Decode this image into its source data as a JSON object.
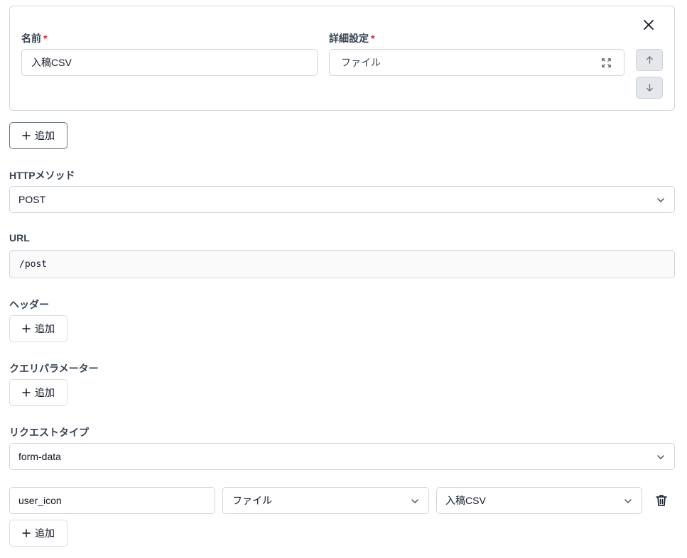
{
  "card": {
    "name_label": "名前",
    "name_required": "*",
    "name_value": "入稿CSV",
    "detail_label": "詳細設定",
    "detail_required": "*",
    "detail_value": "ファイル"
  },
  "add_label": "追加",
  "http_method": {
    "label": "HTTPメソッド",
    "value": "POST"
  },
  "url": {
    "label": "URL",
    "value": "/post"
  },
  "headers": {
    "label": "ヘッダー"
  },
  "query_params": {
    "label": "クエリパラメーター"
  },
  "request_type": {
    "label": "リクエストタイプ",
    "value": "form-data"
  },
  "form_row": {
    "key": "user_icon",
    "type": "ファイル",
    "source": "入稿CSV"
  },
  "icons": [
    "close-icon",
    "arrow-up-icon",
    "arrow-down-icon",
    "expand-icon",
    "plus-icon",
    "chevron-down-icon",
    "trash-icon"
  ]
}
